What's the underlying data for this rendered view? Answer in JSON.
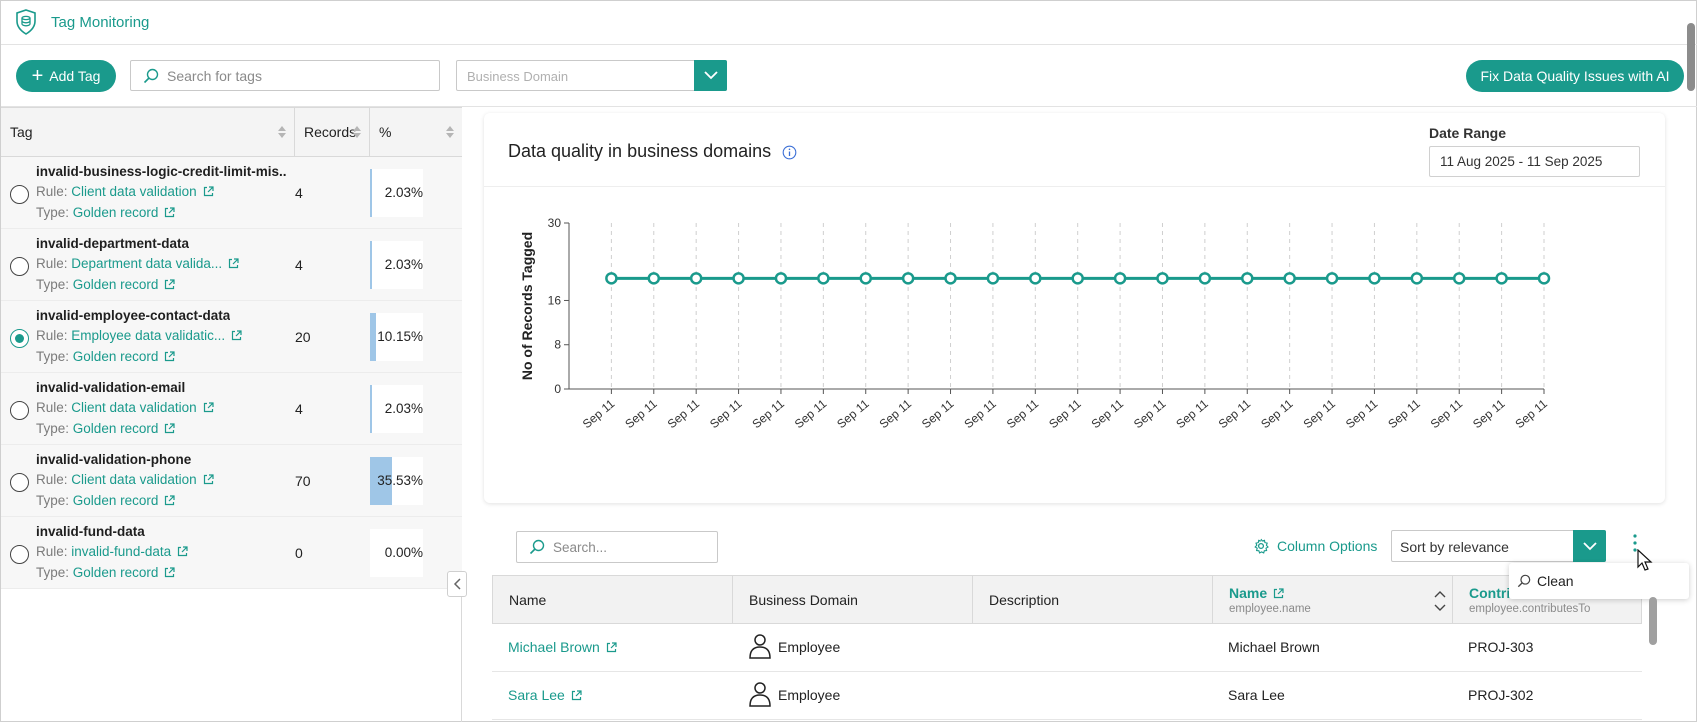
{
  "app": {
    "title": "Tag Monitoring",
    "logo_icon": "shield-database-icon"
  },
  "toolbar": {
    "add_tag": "Add Tag",
    "search_placeholder": "Search for tags",
    "domain_placeholder": "Business Domain",
    "fix_button": "Fix Data Quality Issues with AI"
  },
  "tag_table": {
    "headers": {
      "tag": "Tag",
      "records": "Records",
      "pct": "%"
    },
    "rule_prefix": "Rule:",
    "type_prefix": "Type:",
    "rows": [
      {
        "name": "invalid-business-logic-credit-limit-mis...",
        "rule": "Client data validation",
        "type": "Golden record",
        "records": "4",
        "pct": "2.03%",
        "fraction": 0.0203,
        "selected": false
      },
      {
        "name": "invalid-department-data",
        "rule": "Department data valida...",
        "type": "Golden record",
        "records": "4",
        "pct": "2.03%",
        "fraction": 0.0203,
        "selected": false
      },
      {
        "name": "invalid-employee-contact-data",
        "rule": "Employee data validatic...",
        "type": "Golden record",
        "records": "20",
        "pct": "10.15%",
        "fraction": 0.1015,
        "selected": true
      },
      {
        "name": "invalid-validation-email",
        "rule": "Client data validation",
        "type": "Golden record",
        "records": "4",
        "pct": "2.03%",
        "fraction": 0.0203,
        "selected": false
      },
      {
        "name": "invalid-validation-phone",
        "rule": "Client data validation",
        "type": "Golden record",
        "records": "70",
        "pct": "35.53%",
        "fraction": 0.3553,
        "selected": false
      },
      {
        "name": "invalid-fund-data",
        "rule": "invalid-fund-data",
        "type": "Golden record",
        "records": "0",
        "pct": "0.00%",
        "fraction": 0,
        "selected": false
      }
    ]
  },
  "chart_panel": {
    "title": "Data quality in business domains",
    "date_range_label": "Date Range",
    "date_range_value": "11 Aug 2025 - 11 Sep 2025"
  },
  "chart_data": {
    "type": "line",
    "title": "Data quality in business domains",
    "xlabel": "",
    "ylabel": "No of Records Tagged",
    "ylim": [
      0,
      30
    ],
    "yticks": [
      0,
      8,
      16,
      30
    ],
    "x": [
      "Sep 11",
      "Sep 11",
      "Sep 11",
      "Sep 11",
      "Sep 11",
      "Sep 11",
      "Sep 11",
      "Sep 11",
      "Sep 11",
      "Sep 11",
      "Sep 11",
      "Sep 11",
      "Sep 11",
      "Sep 11",
      "Sep 11",
      "Sep 11",
      "Sep 11",
      "Sep 11",
      "Sep 11",
      "Sep 11",
      "Sep 11",
      "Sep 11",
      "Sep 11"
    ],
    "series": [
      {
        "values": [
          20,
          20,
          20,
          20,
          20,
          20,
          20,
          20,
          20,
          20,
          20,
          20,
          20,
          20,
          20,
          20,
          20,
          20,
          20,
          20,
          20,
          20,
          20
        ],
        "color": "#1a9a8c"
      }
    ],
    "grid": "vertical dashed"
  },
  "grid_toolbar": {
    "search_placeholder": "Search...",
    "column_options": "Column Options",
    "sort_value": "Sort by relevance",
    "menu_item": "Clean"
  },
  "records_grid": {
    "headers": [
      {
        "label": "Name",
        "sub": ""
      },
      {
        "label": "Business Domain",
        "sub": ""
      },
      {
        "label": "Description",
        "sub": ""
      },
      {
        "label": "Name",
        "sub": "employee.name"
      },
      {
        "label": "Contri",
        "sub": "employee.contributesTo"
      }
    ],
    "rows": [
      {
        "name": "Michael Brown",
        "domain": "Employee",
        "description": "",
        "emp_name": "Michael Brown",
        "contrib": "PROJ-303"
      },
      {
        "name": "Sara Lee",
        "domain": "Employee",
        "description": "",
        "emp_name": "Sara Lee",
        "contrib": "PROJ-302"
      }
    ]
  },
  "colors": {
    "accent": "#1a9a8c",
    "bar": "#9fc6e7"
  }
}
